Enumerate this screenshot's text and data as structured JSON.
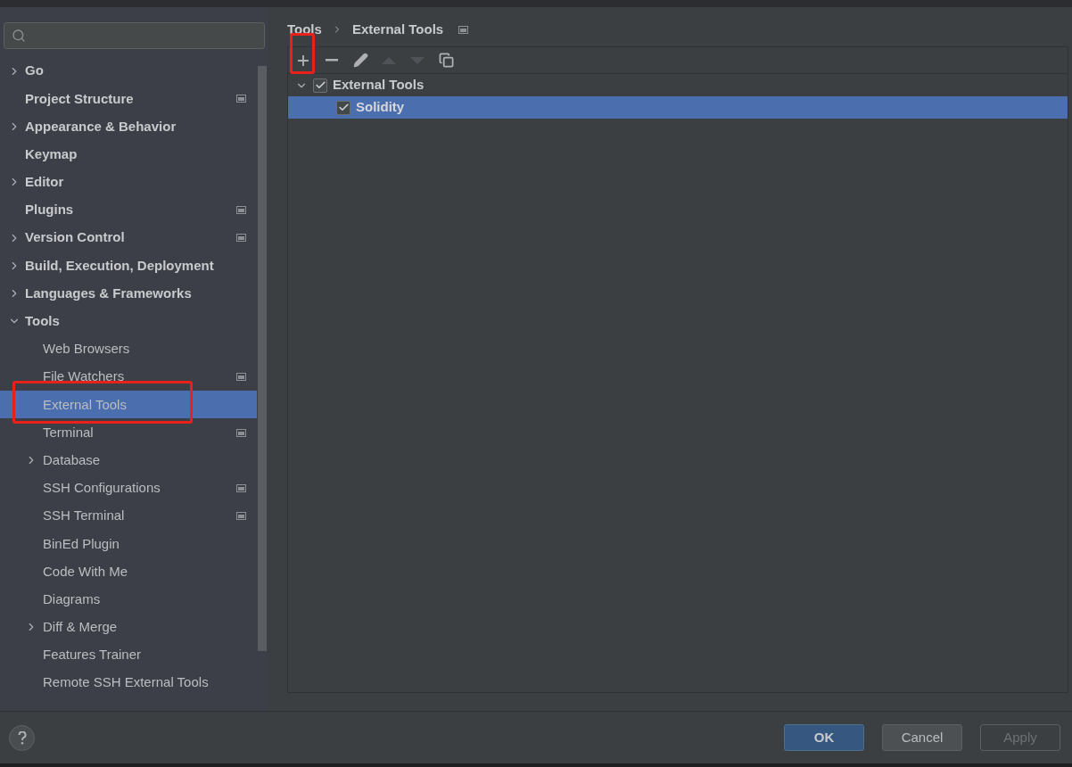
{
  "sidebar": {
    "items": [
      {
        "label": "Go",
        "expanded": false,
        "has_children": true,
        "selected": false,
        "project_scope": false
      },
      {
        "label": "Project Structure",
        "has_children": false,
        "selected": false,
        "project_scope": true
      },
      {
        "label": "Appearance & Behavior",
        "expanded": false,
        "has_children": true,
        "selected": false,
        "project_scope": false
      },
      {
        "label": "Keymap",
        "has_children": false,
        "selected": false,
        "project_scope": false
      },
      {
        "label": "Editor",
        "expanded": false,
        "has_children": true,
        "selected": false,
        "project_scope": false
      },
      {
        "label": "Plugins",
        "has_children": false,
        "selected": false,
        "project_scope": true
      },
      {
        "label": "Version Control",
        "expanded": false,
        "has_children": true,
        "selected": false,
        "project_scope": true
      },
      {
        "label": "Build, Execution, Deployment",
        "expanded": false,
        "has_children": true,
        "selected": false,
        "project_scope": false
      },
      {
        "label": "Languages & Frameworks",
        "expanded": false,
        "has_children": true,
        "selected": false,
        "project_scope": false
      },
      {
        "label": "Tools",
        "expanded": true,
        "has_children": true,
        "selected": false,
        "project_scope": false,
        "children": [
          {
            "label": "Web Browsers",
            "has_children": false,
            "selected": false,
            "project_scope": false
          },
          {
            "label": "File Watchers",
            "has_children": false,
            "selected": false,
            "project_scope": true
          },
          {
            "label": "External Tools",
            "has_children": false,
            "selected": true,
            "project_scope": false,
            "highlighted": true
          },
          {
            "label": "Terminal",
            "has_children": false,
            "selected": false,
            "project_scope": true
          },
          {
            "label": "Database",
            "expanded": false,
            "has_children": true,
            "selected": false,
            "project_scope": false
          },
          {
            "label": "SSH Configurations",
            "has_children": false,
            "selected": false,
            "project_scope": true
          },
          {
            "label": "SSH Terminal",
            "has_children": false,
            "selected": false,
            "project_scope": true
          },
          {
            "label": "BinEd Plugin",
            "has_children": false,
            "selected": false,
            "project_scope": false
          },
          {
            "label": "Code With Me",
            "has_children": false,
            "selected": false,
            "project_scope": false
          },
          {
            "label": "Diagrams",
            "has_children": false,
            "selected": false,
            "project_scope": false
          },
          {
            "label": "Diff & Merge",
            "expanded": false,
            "has_children": true,
            "selected": false,
            "project_scope": false
          },
          {
            "label": "Features Trainer",
            "has_children": false,
            "selected": false,
            "project_scope": false
          },
          {
            "label": "Remote SSH External Tools",
            "has_children": false,
            "selected": false,
            "project_scope": false
          }
        ]
      }
    ]
  },
  "breadcrumb": [
    {
      "label": "Tools"
    },
    {
      "label": "External Tools"
    }
  ],
  "toolbar": [
    {
      "kind": "add",
      "disabled": false,
      "highlighted": true
    },
    {
      "kind": "remove",
      "disabled": false,
      "highlighted": false
    },
    {
      "kind": "edit",
      "disabled": false,
      "highlighted": false
    },
    {
      "kind": "up",
      "disabled": true,
      "highlighted": false
    },
    {
      "kind": "down",
      "disabled": true,
      "highlighted": false
    },
    {
      "kind": "copy",
      "disabled": false,
      "highlighted": false
    }
  ],
  "tool_tree": [
    {
      "label": "External Tools",
      "checked": true,
      "expanded": true,
      "selected": false,
      "children": [
        {
          "label": "Solidity",
          "checked": true,
          "selected": true
        }
      ]
    }
  ],
  "buttons": [
    {
      "label": "OK",
      "kind": "primary",
      "disabled": false
    },
    {
      "label": "Cancel",
      "kind": "normal",
      "disabled": false
    },
    {
      "label": "Apply",
      "kind": "normal",
      "disabled": true
    }
  ]
}
